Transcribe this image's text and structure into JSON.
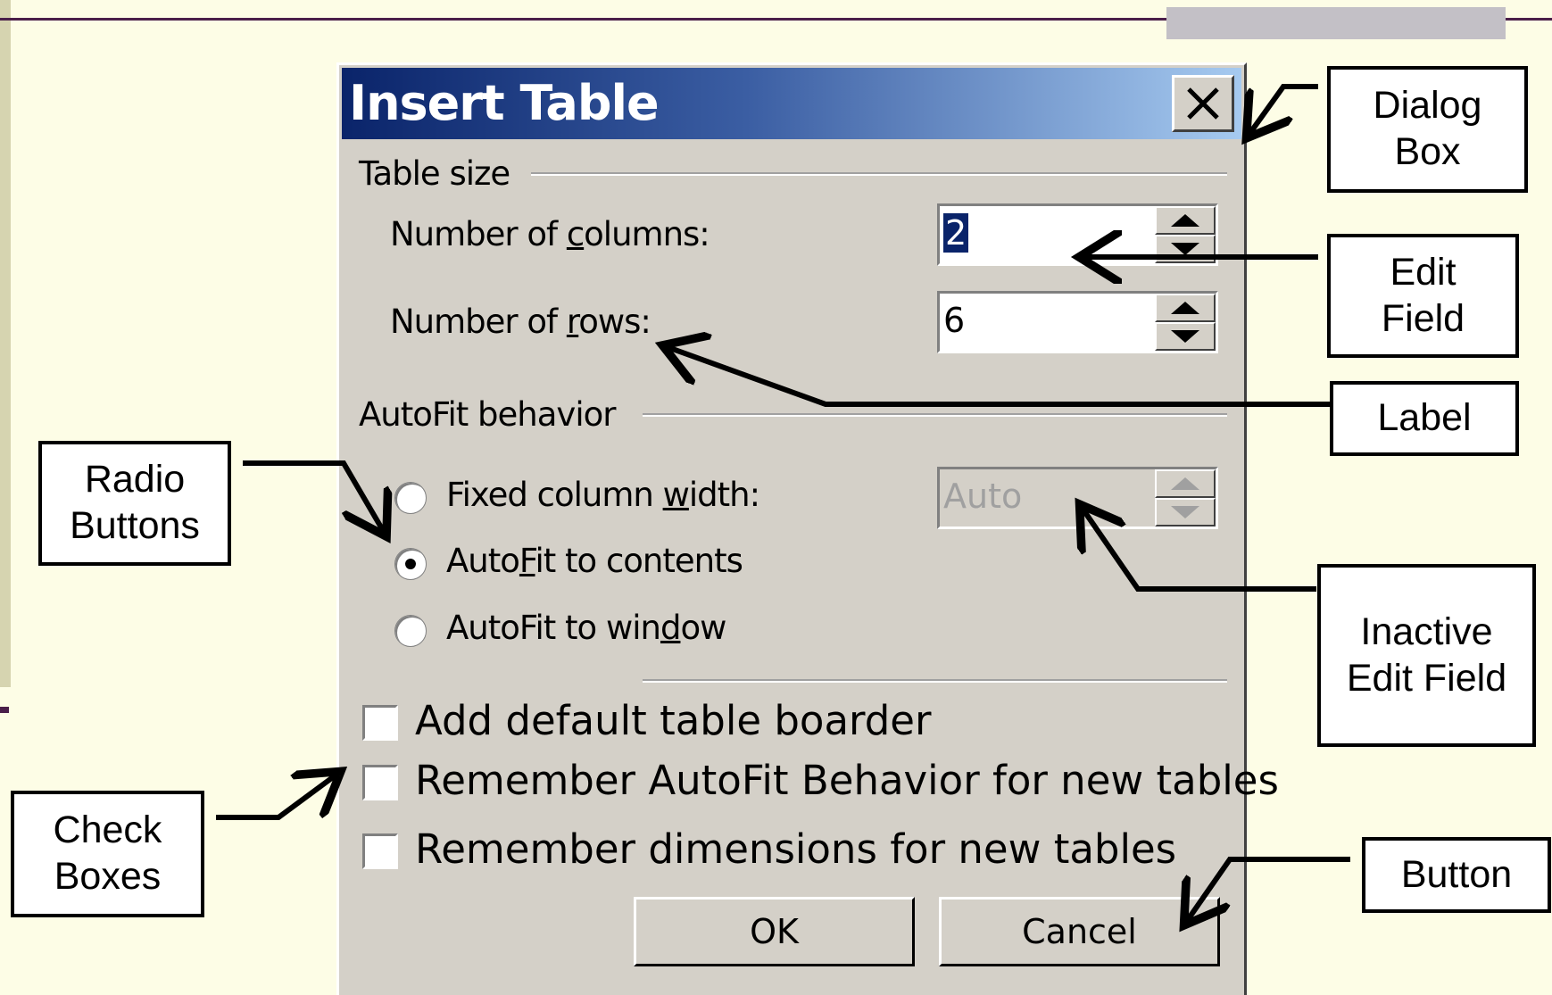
{
  "dialog": {
    "title": "Insert Table",
    "table_size_group": "Table size",
    "columns_label_pre": "Number of ",
    "columns_label_key": "c",
    "columns_label_post": "olumns:",
    "columns_value": "2",
    "rows_label_pre": "Number of ",
    "rows_label_key": "r",
    "rows_label_post": "ows:",
    "rows_value": "6",
    "autofit_group": "AutoFit behavior",
    "radio_fixed_pre": "Fixed column ",
    "radio_fixed_key": "w",
    "radio_fixed_post": "idth:",
    "fixed_width_value": "Auto",
    "radio_contents_pre": "Auto",
    "radio_contents_key": "F",
    "radio_contents_post": "it to contents",
    "radio_window_pre": "AutoFit to win",
    "radio_window_key": "d",
    "radio_window_post": "ow",
    "selected_radio": "AutoFit to contents",
    "checkbox_border": "Add default table boarder",
    "checkbox_remember_autofit": "Remember AutoFit Behavior for new tables",
    "checkbox_remember_dimensions": "Remember dimensions for new tables",
    "ok_label": "OK",
    "cancel_label": "Cancel"
  },
  "callouts": {
    "dialog_box": "Dialog\nBox",
    "edit_field": "Edit\nField",
    "label": "Label",
    "radio_buttons": "Radio\nButtons",
    "inactive_edit_field": "Inactive\nEdit Field",
    "check_boxes": "Check\nBoxes",
    "button": "Button"
  },
  "icons": {
    "close": "close-icon",
    "spin_up": "spin-up-icon",
    "spin_down": "spin-down-icon"
  },
  "colors": {
    "slide_background": "#fdfde6",
    "dialog_face": "#d4d0c8",
    "titlebar_start": "#0a246a",
    "titlebar_end": "#a6caf0",
    "selection": "#0a246a",
    "slide_rule": "#4a1f4a"
  }
}
